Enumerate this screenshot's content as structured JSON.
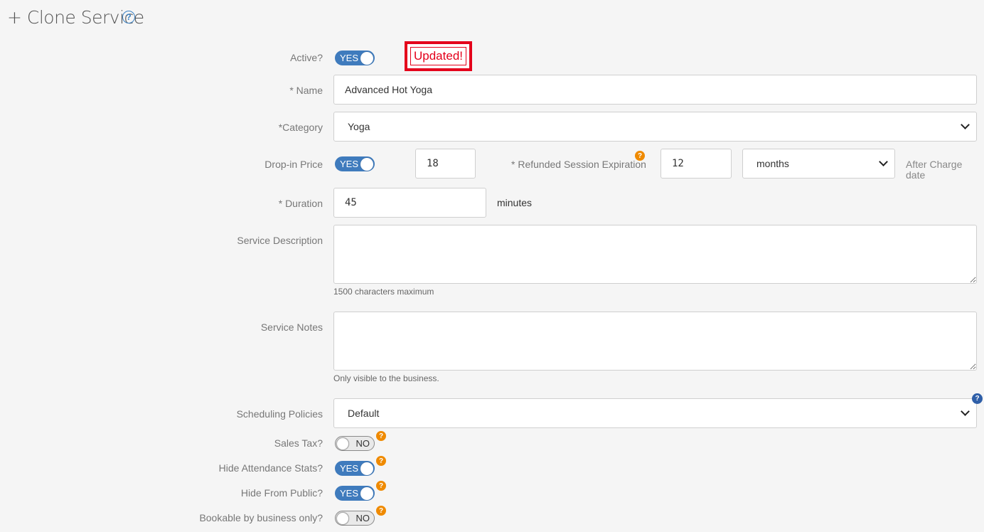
{
  "header": {
    "title": "+ Clone Service",
    "help_icon": "question-circle-icon",
    "help_symbol": "?"
  },
  "annotation": {
    "text": "Updated!",
    "color": "#e4001b"
  },
  "form": {
    "active": {
      "label": "Active?",
      "value": "YES"
    },
    "name": {
      "label": "* Name",
      "value": "Advanced Hot Yoga"
    },
    "category": {
      "label": "*Category",
      "value": "Yoga"
    },
    "drop_in_price": {
      "label": "Drop-in Price",
      "toggle": "YES",
      "value": "18"
    },
    "refunded_session_expiration": {
      "label": "* Refunded Session Expiration",
      "value": "12",
      "unit": "months",
      "suffix": "After Charge date"
    },
    "duration": {
      "label": "* Duration",
      "value": "45",
      "unit": "minutes"
    },
    "service_description": {
      "label": "Service Description",
      "value": "",
      "hint": "1500 characters maximum"
    },
    "service_notes": {
      "label": "Service Notes",
      "value": "",
      "hint": "Only visible to the business."
    },
    "scheduling_policies": {
      "label": "Scheduling Policies",
      "value": "Default"
    },
    "sales_tax": {
      "label": "Sales Tax?",
      "value": "NO"
    },
    "hide_attendance_stats": {
      "label": "Hide Attendance Stats?",
      "value": "YES"
    },
    "hide_from_public": {
      "label": "Hide From Public?",
      "value": "YES"
    },
    "bookable_by_business_only": {
      "label": "Bookable by business only?",
      "value": "NO"
    }
  },
  "help_marker": "?",
  "colors": {
    "accent": "#3f7bbd",
    "help_orange": "#ef8a00",
    "help_blue": "#2f5fa8"
  }
}
